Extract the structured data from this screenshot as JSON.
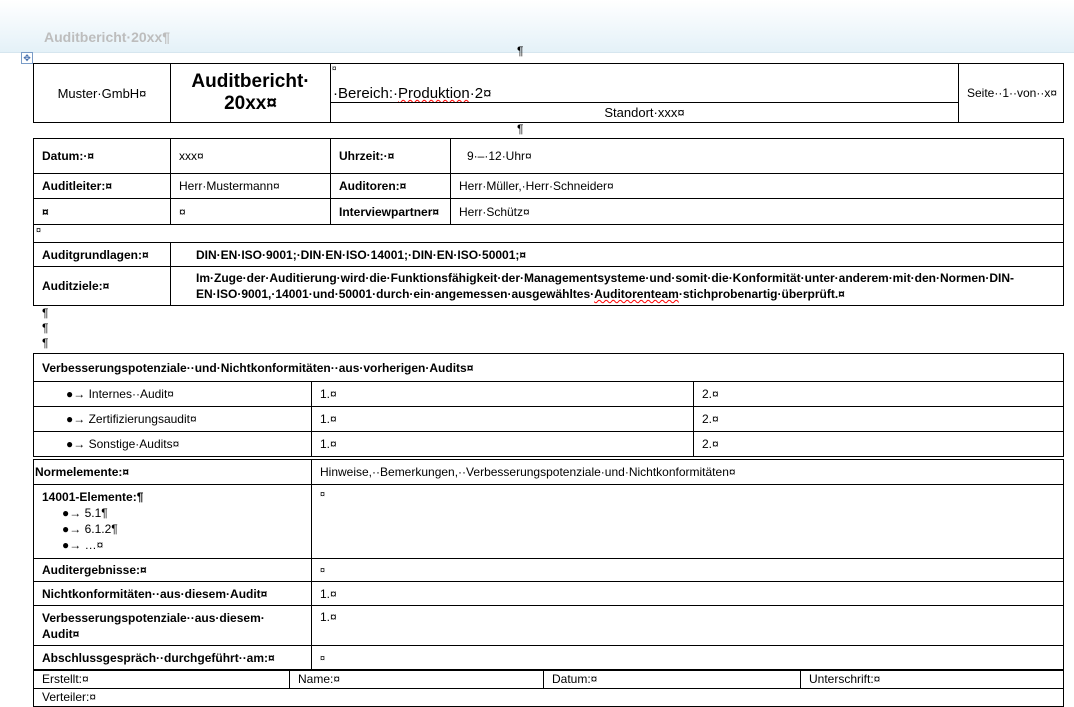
{
  "header_text": "Auditbericht·20xx¶",
  "title_table": {
    "company": "Muster·GmbH¤",
    "title_line1": "Auditbericht·",
    "title_line2": "20xx¤",
    "area_prefix": "·Bereich:·",
    "area_word": "Produktion",
    "area_suffix": "·2¤",
    "location": "Standort·xxx¤",
    "page": "Seite··1··von··x¤",
    "cell_mark": "¤"
  },
  "pilcrow": "¶",
  "info": {
    "date_label": "Datum:·¤",
    "date_value": "xxx¤",
    "time_label": "Uhrzeit:·¤",
    "time_value": "9·–·12·Uhr¤",
    "lead_label": "Auditleiter:¤",
    "lead_value": "Herr·Mustermann¤",
    "auditors_label": "Auditoren:¤",
    "auditors_value": "Herr·Müller,·Herr·Schneider¤",
    "empty1": "¤",
    "empty2": "¤",
    "interview_label": "Interviewpartner¤",
    "interview_value": "Herr·Schütz¤"
  },
  "basis": {
    "spacer": "¤",
    "basis_label": "Auditgrundlagen:¤",
    "basis_value": "DIN·EN·ISO·9001;·DIN·EN·ISO·14001;·DIN·EN·ISO·50001;¤",
    "goals_label": "Auditziele:¤",
    "goals_line1": "Im·Zuge·der·Auditierung·wird·die·Funktionsfähigkeit·der·Managementsysteme·und·somit·die·Konformität·unter·anderem·mit·den·Normen·DIN-",
    "goals_line2a": "EN·ISO·9001,·14001·und·50001·durch·ein·angemessen·ausgewähltes·",
    "goals_word": "Auditorenteam",
    "goals_line2b": "·stichprobenartig·überprüft.¤"
  },
  "previous": {
    "title": "Verbesserungspotenziale··und·Nichtkonformitäten··aus·vorherigen·Audits¤",
    "rows": [
      {
        "label": "Internes··Audit¤",
        "c1": "1.¤",
        "c2": "2.¤"
      },
      {
        "label": "Zertifizierungsaudit¤",
        "c1": "1.¤",
        "c2": "2.¤"
      },
      {
        "label": "Sonstige·Audits¤",
        "c1": "1.¤",
        "c2": "2.¤"
      }
    ],
    "bullet": "●→"
  },
  "elements": {
    "norm_label": "Normelemente:¤",
    "norm_value": "Hinweise,··Bemerkungen,··Verbesserungspotenziale·und·Nichtkonformitäten¤",
    "iso_label": "14001-Elemente:¶",
    "iso_items": [
      "5.1¶",
      "6.1.2¶",
      "…¤"
    ],
    "iso_value": "¤",
    "results_label": "Auditergebnisse:¤",
    "results_value": "¤",
    "nc_label": "Nichtkonformitäten··aus·diesem·Audit¤",
    "nc_value": "1.¤",
    "imp_label1": "Verbesserungspotenziale··aus·diesem·",
    "imp_label2": "Audit¤",
    "imp_value": "1.¤",
    "closing_label": "Abschlussgespräch··durchgeführt··am:¤",
    "closing_value": "¤"
  },
  "footer": {
    "created": "Erstellt:¤",
    "name": "Name:¤",
    "date": "Datum:¤",
    "signature": "Unterschrift:¤",
    "distribution": "Verteiler:¤"
  }
}
